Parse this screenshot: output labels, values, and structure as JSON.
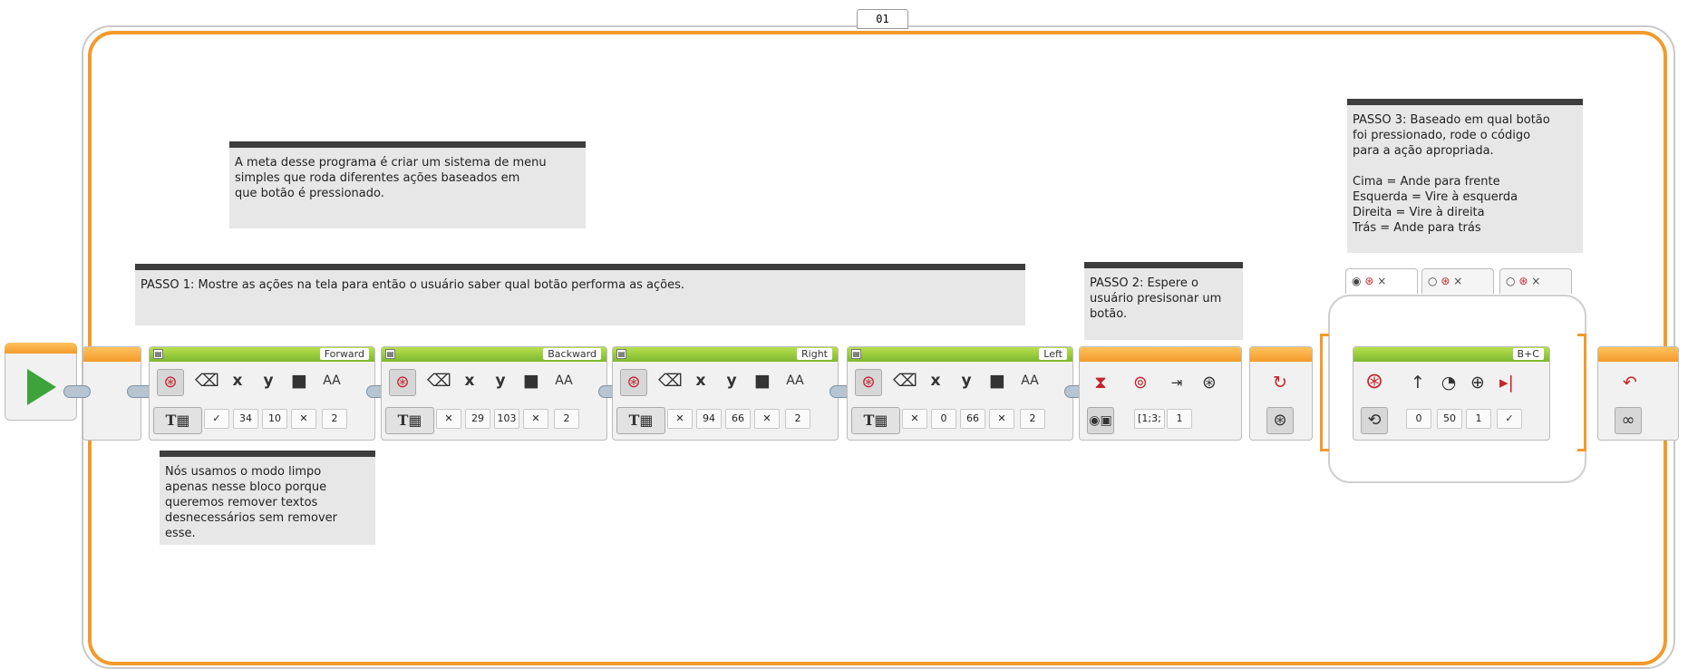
{
  "loop": {
    "id": "01"
  },
  "comments": {
    "intro": "A meta desse programa é criar um sistema de menu\nsimples que roda diferentes ações baseados em\nque botão é pressionado.",
    "step1": "PASSO 1: Mostre as ações na tela para então o usuário saber qual botão performa as ações.",
    "step2": "PASSO 2: Espere o\nusuário presisonar um\nbotão.",
    "step3": "PASSO 3: Baseado em qual botão\nfoi pressionado, rode o código\npara a ação apropriada.\n\nCima = Ande para frente\nEsquerda = Vire à esquerda\nDireita = Vire à direita\nTrás = Ande para trás",
    "clear_note": "Nós usamos o modo limpo\napenas nesse bloco porque\nqueremos remover textos\ndesnecessários sem remover\nesse."
  },
  "display_blocks": [
    {
      "title": "Forward",
      "clear": "✓",
      "x": "34",
      "y": "10",
      "invert": "✕",
      "size": "2"
    },
    {
      "title": "Backward",
      "clear": "✕",
      "x": "29",
      "y": "103",
      "invert": "✕",
      "size": "2"
    },
    {
      "title": "Right",
      "clear": "✕",
      "x": "94",
      "y": "66",
      "invert": "✕",
      "size": "2"
    },
    {
      "title": "Left",
      "clear": "✕",
      "x": "0",
      "y": "66",
      "invert": "✕",
      "size": "2"
    }
  ],
  "display_labels": {
    "x": "x",
    "y": "y",
    "font": "AA",
    "text_mode": "T"
  },
  "wait_block": {
    "buttons": "[1;3;",
    "state": "1"
  },
  "move_block": {
    "ports": "B+C",
    "steering": "0",
    "power": "50",
    "rotations": "1",
    "brake": "✓"
  },
  "switch_tabs": [
    "×",
    "×",
    "×"
  ],
  "colors": {
    "loop": "#f39a2b",
    "display_header": "#7cb82f",
    "comment_bar": "#3d3d3d",
    "start_play": "#3fa33b"
  },
  "icons": [
    "play-icon",
    "brick-button-icon",
    "eraser-icon",
    "invert-color-icon",
    "hourglass-icon",
    "steering-icon",
    "loop-infinity-icon"
  ]
}
